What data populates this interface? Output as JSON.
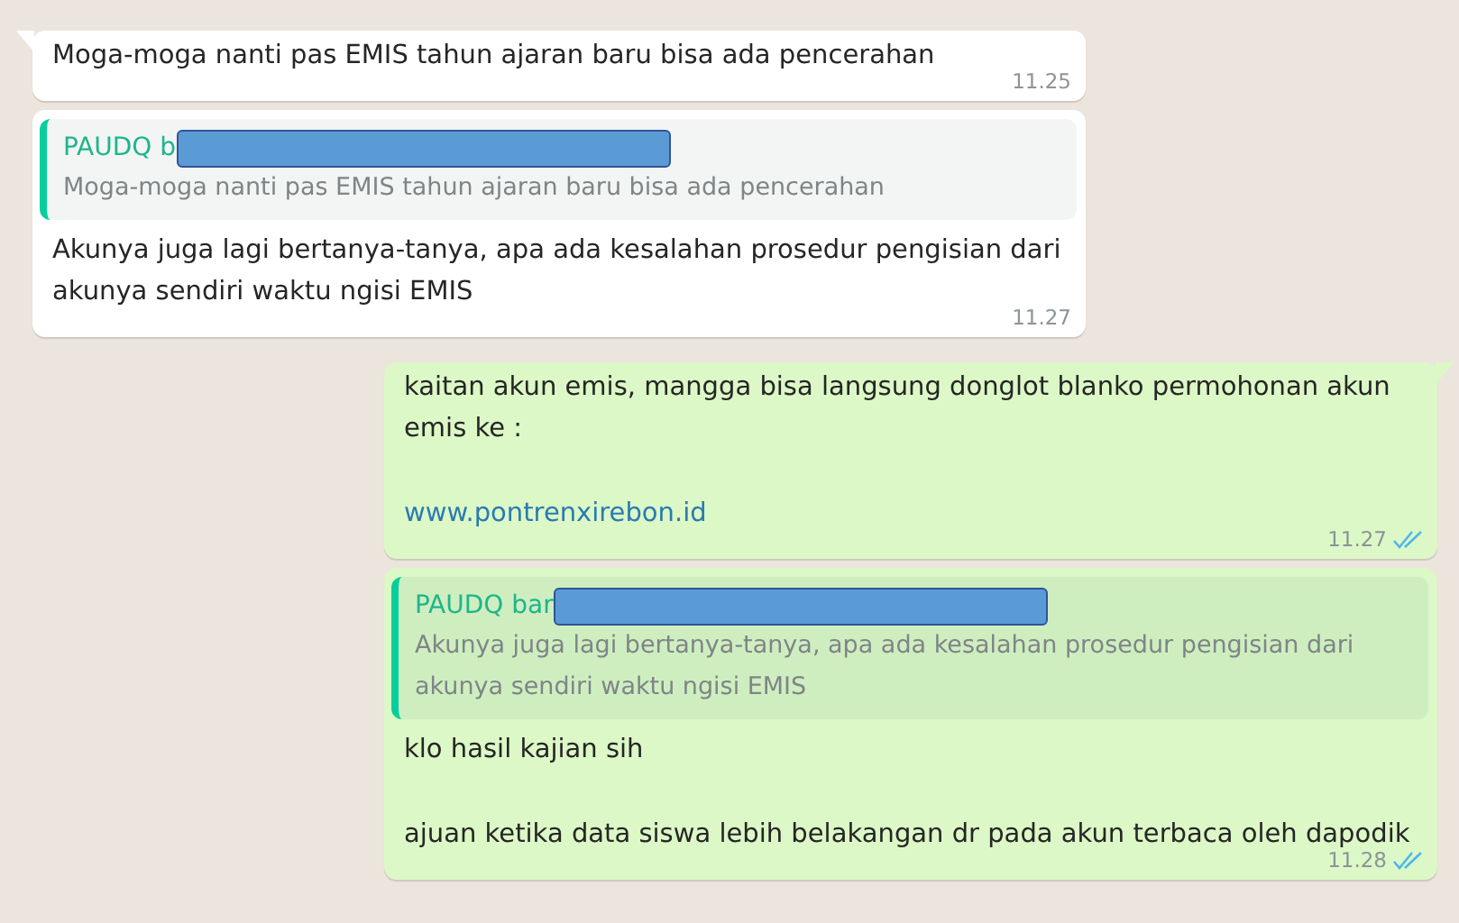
{
  "messages": [
    {
      "outgoing": false,
      "tail": true,
      "lines": [
        {
          "kind": "text",
          "text": "Moga-moga nanti pas EMIS tahun ajaran baru bisa ada pencerahan"
        }
      ],
      "time": "11.25"
    },
    {
      "outgoing": false,
      "tail": false,
      "quote": {
        "sender": "PAUDQ b",
        "redacted": true,
        "text": "Moga-moga nanti pas EMIS tahun ajaran baru bisa ada pencerahan"
      },
      "lines": [
        {
          "kind": "text",
          "text": "Akunya juga lagi bertanya-tanya, apa ada kesalahan prosedur pengisian dari akunya sendiri waktu ngisi EMIS"
        }
      ],
      "time": "11.27"
    },
    {
      "outgoing": true,
      "tail": true,
      "lines": [
        {
          "kind": "text",
          "text": "kaitan akun emis, mangga bisa langsung donglot blanko permohonan akun emis ke :"
        },
        {
          "kind": "link",
          "text": "www.pontrenxirebon.id"
        }
      ],
      "time": "11.27",
      "read": true
    },
    {
      "outgoing": true,
      "tail": false,
      "quote": {
        "sender": "PAUDQ bar",
        "redacted": true,
        "text": "Akunya juga lagi bertanya-tanya, apa ada kesalahan prosedur pengisian dari akunya sendiri waktu ngisi EMIS"
      },
      "lines": [
        {
          "kind": "text",
          "text": "klo hasil kajian sih"
        },
        {
          "kind": "text",
          "text": "ajuan ketika data siswa lebih belakangan dr pada akun terbaca oleh dapodik"
        }
      ],
      "time": "11.28",
      "read": true
    }
  ]
}
